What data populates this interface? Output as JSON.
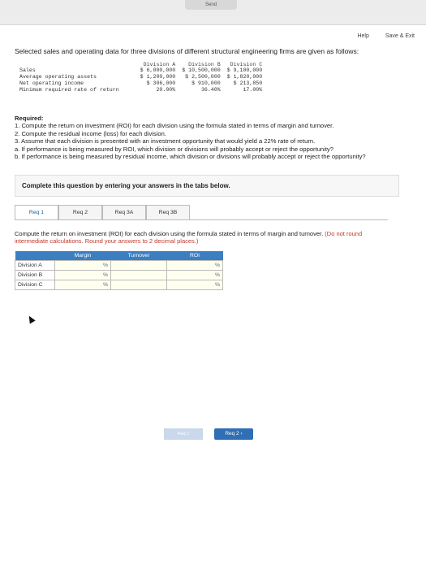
{
  "topbar": {
    "send_label": "Send"
  },
  "links": {
    "help": "Help",
    "save_exit": "Save & Exit"
  },
  "intro": "Selected sales and operating data for three divisions of different structural engineering firms are given as follows:",
  "data_table": {
    "headers": [
      "Division A",
      "Division B",
      "Division C"
    ],
    "rows": [
      {
        "label": "Sales",
        "values": [
          "$ 6,000,000",
          "$ 10,500,000",
          "$ 9,100,000"
        ]
      },
      {
        "label": "Average operating assets",
        "values": [
          "$ 1,200,000",
          "$ 2,500,000",
          "$ 1,820,000"
        ]
      },
      {
        "label": "Net operating income",
        "values": [
          "$ 306,000",
          "$ 910,000",
          "$ 213,850"
        ]
      },
      {
        "label": "Minimum required rate of return",
        "values": [
          "20.00%",
          "36.40%",
          "17.00%"
        ]
      }
    ]
  },
  "required": {
    "heading": "Required:",
    "items": [
      "1. Compute the return on investment (ROI) for each division using the formula stated in terms of margin and turnover.",
      "2. Compute the residual income (loss) for each division.",
      "3. Assume that each division is presented with an investment opportunity that would yield a 22% rate of return.",
      "a. If performance is being measured by ROI, which division or divisions will probably accept or reject the opportunity?",
      "b. If performance is being measured by residual income, which division or divisions will probably accept or reject the opportunity?"
    ]
  },
  "complete_text": "Complete this question by entering your answers in the tabs below.",
  "tabs": [
    "Req 1",
    "Req 2",
    "Req 3A",
    "Req 3B"
  ],
  "instructions": {
    "main": "Compute the return on investment (ROI) for each division using the formula stated in terms of margin and turnover.",
    "red": "(Do not round intermediate calculations. Round your answers to 2 decimal places.)"
  },
  "roi_table": {
    "headers": [
      "",
      "Margin",
      "Turnover",
      "ROI"
    ],
    "rows": [
      {
        "label": "Division A",
        "margin": "",
        "margin_unit": "%",
        "turnover": "",
        "roi": "",
        "roi_unit": "%"
      },
      {
        "label": "Division B",
        "margin": "",
        "margin_unit": "%",
        "turnover": "",
        "roi": "",
        "roi_unit": "%"
      },
      {
        "label": "Division C",
        "margin": "",
        "margin_unit": "%",
        "turnover": "",
        "roi": "",
        "roi_unit": "%"
      }
    ]
  },
  "nav": {
    "prev_label": "Req 1",
    "next_label": "Req 2  ›"
  }
}
